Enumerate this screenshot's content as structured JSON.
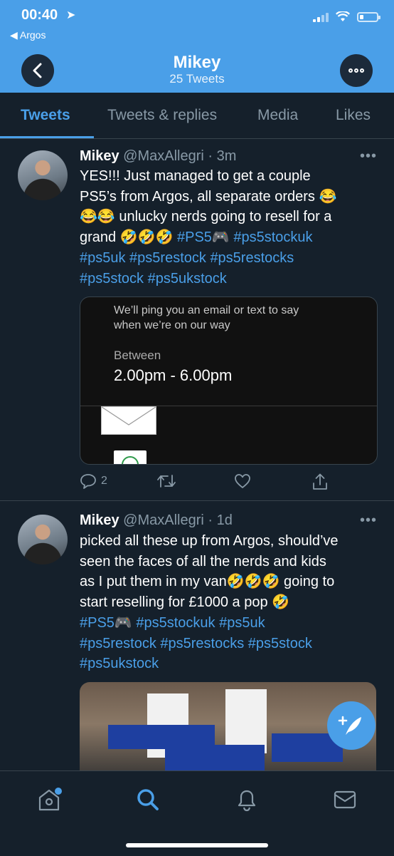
{
  "status": {
    "time": "00:40",
    "location_icon": "location-arrow-icon",
    "back_app": "◀ Argos"
  },
  "header": {
    "title": "Mikey",
    "subtitle": "25 Tweets"
  },
  "tabs": [
    {
      "label": "Tweets",
      "active": true
    },
    {
      "label": "Tweets & replies",
      "active": false
    },
    {
      "label": "Media",
      "active": false
    },
    {
      "label": "Likes",
      "active": false
    }
  ],
  "tweets": [
    {
      "name": "Mikey",
      "handle": "@MaxAllegri",
      "time": "· 3m",
      "lines": [
        "YES!!! Just managed to get a couple",
        "PS5’s from Argos, all separate orders 😂",
        "😂😂 unlucky nerds going to resell for a",
        "grand 🤣🤣🤣 "
      ],
      "tags_line3": "#PS5🎮 #ps5stockuk",
      "tags_line4": "#ps5uk #ps5restock #ps5restocks",
      "tags_line5": "#ps5stock #ps5ukstock",
      "card": {
        "message_line1": "We’ll ping you an email or text to say",
        "message_line2": "when we’re on our way",
        "between_label": "Between",
        "time_window": "2.00pm - 6.00pm"
      },
      "reply_count": "2"
    },
    {
      "name": "Mikey",
      "handle": "@MaxAllegri",
      "time": "· 1d",
      "lines": [
        "picked all these up from Argos, should’ve",
        "seen the faces of all the nerds and kids",
        "as I put them in my van🤣🤣🤣 going to",
        "start reselling for £1000 a pop 🤣"
      ],
      "tags_line5": "#PS5🎮    #ps5stockuk #ps5uk",
      "tags_line6": "#ps5restock #ps5restocks #ps5stock",
      "tags_line7": "#ps5ukstock"
    }
  ],
  "more_dots": "•••",
  "colors": {
    "accent": "#4a9fe8",
    "background": "#15202b",
    "muted": "#8899a6",
    "border": "#38444d"
  }
}
